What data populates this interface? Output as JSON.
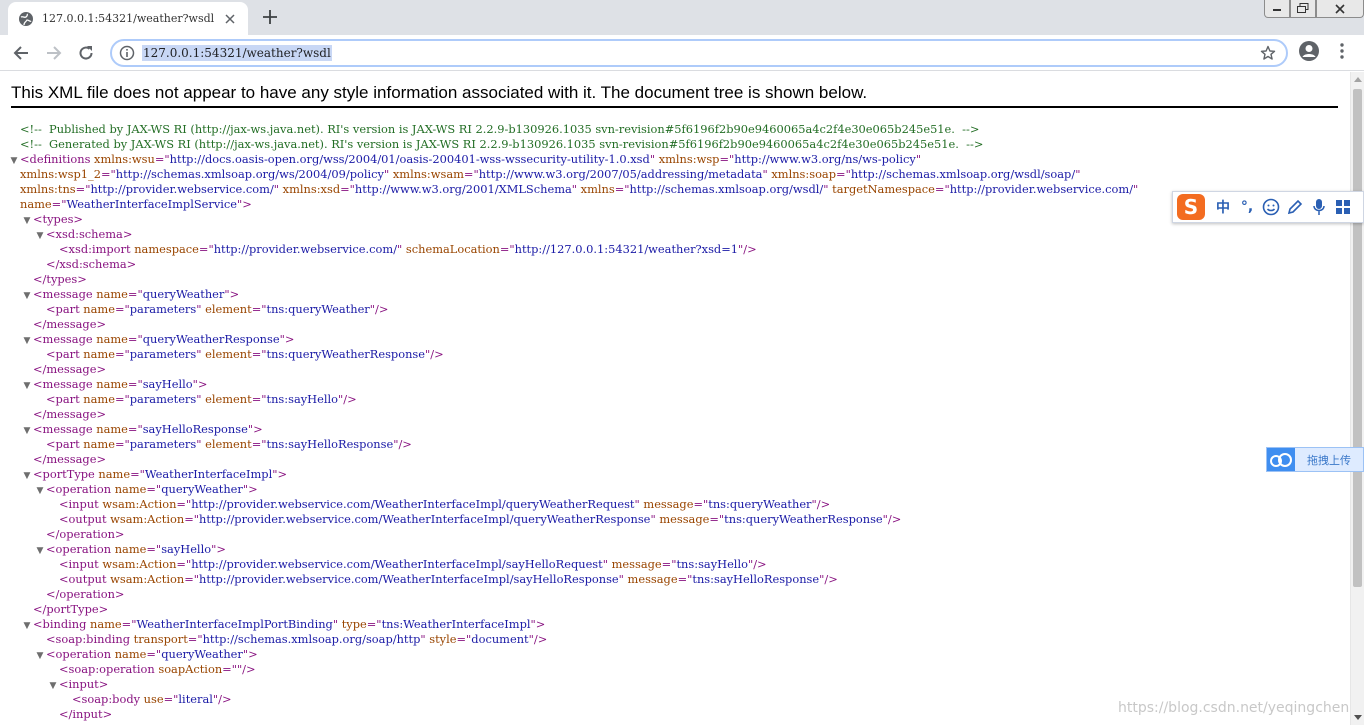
{
  "tab": {
    "title": "127.0.0.1:54321/weather?wsdl",
    "favicon": "globe-icon"
  },
  "address": {
    "url": "127.0.0.1:54321/weather?wsdl"
  },
  "banner": "This XML file does not appear to have any style information associated with it. The document tree is shown below.",
  "ime": {
    "items": [
      "中",
      "°,"
    ]
  },
  "upload": {
    "label": "拖拽上传"
  },
  "watermark": "https://blog.csdn.net/yeqingchen",
  "xml_lines": [
    {
      "tw": "",
      "indent": 0,
      "parts": [
        [
          "c",
          "<!--  Published by JAX-WS RI (http://jax-ws.java.net). RI's version is JAX-WS RI 2.2.9-b130926.1035 svn-revision#5f6196f2b90e9460065a4c2f4e30e065b245e51e.  -->"
        ]
      ]
    },
    {
      "tw": "",
      "indent": 0,
      "parts": [
        [
          "c",
          "<!--  Generated by JAX-WS RI (http://jax-ws.java.net). RI's version is JAX-WS RI 2.2.9-b130926.1035 svn-revision#5f6196f2b90e9460065a4c2f4e30e065b245e51e.  -->"
        ]
      ]
    },
    {
      "tw": "▼",
      "indent": 0,
      "parts": [
        [
          "t",
          "<definitions "
        ],
        [
          "a",
          "xmlns:wsu"
        ],
        [
          "t",
          "=\""
        ],
        [
          "v",
          "http://docs.oasis-open.org/wss/2004/01/oasis-200401-wss-wssecurity-utility-1.0.xsd"
        ],
        [
          "t",
          "\" "
        ],
        [
          "a",
          "xmlns:wsp"
        ],
        [
          "t",
          "=\""
        ],
        [
          "v",
          "http://www.w3.org/ns/ws-policy"
        ],
        [
          "t",
          "\""
        ]
      ]
    },
    {
      "tw": "",
      "indent": 0,
      "parts": [
        [
          "a",
          "xmlns:wsp1_2"
        ],
        [
          "t",
          "=\""
        ],
        [
          "v",
          "http://schemas.xmlsoap.org/ws/2004/09/policy"
        ],
        [
          "t",
          "\" "
        ],
        [
          "a",
          "xmlns:wsam"
        ],
        [
          "t",
          "=\""
        ],
        [
          "v",
          "http://www.w3.org/2007/05/addressing/metadata"
        ],
        [
          "t",
          "\" "
        ],
        [
          "a",
          "xmlns:soap"
        ],
        [
          "t",
          "=\""
        ],
        [
          "v",
          "http://schemas.xmlsoap.org/wsdl/soap/"
        ],
        [
          "t",
          "\""
        ]
      ]
    },
    {
      "tw": "",
      "indent": 0,
      "parts": [
        [
          "a",
          "xmlns:tns"
        ],
        [
          "t",
          "=\""
        ],
        [
          "v",
          "http://provider.webservice.com/"
        ],
        [
          "t",
          "\" "
        ],
        [
          "a",
          "xmlns:xsd"
        ],
        [
          "t",
          "=\""
        ],
        [
          "v",
          "http://www.w3.org/2001/XMLSchema"
        ],
        [
          "t",
          "\" "
        ],
        [
          "a",
          "xmlns"
        ],
        [
          "t",
          "=\""
        ],
        [
          "v",
          "http://schemas.xmlsoap.org/wsdl/"
        ],
        [
          "t",
          "\" "
        ],
        [
          "a",
          "targetNamespace"
        ],
        [
          "t",
          "=\""
        ],
        [
          "v",
          "http://provider.webservice.com/"
        ],
        [
          "t",
          "\""
        ]
      ]
    },
    {
      "tw": "",
      "indent": 0,
      "parts": [
        [
          "a",
          "name"
        ],
        [
          "t",
          "=\""
        ],
        [
          "v",
          "WeatherInterfaceImplService"
        ],
        [
          "t",
          "\">"
        ]
      ]
    },
    {
      "tw": "▼",
      "indent": 1,
      "parts": [
        [
          "t",
          "<types>"
        ]
      ]
    },
    {
      "tw": "▼",
      "indent": 2,
      "parts": [
        [
          "t",
          "<xsd:schema>"
        ]
      ]
    },
    {
      "tw": "",
      "indent": 3,
      "parts": [
        [
          "t",
          "<xsd:import "
        ],
        [
          "a",
          "namespace"
        ],
        [
          "t",
          "=\""
        ],
        [
          "v",
          "http://provider.webservice.com/"
        ],
        [
          "t",
          "\" "
        ],
        [
          "a",
          "schemaLocation"
        ],
        [
          "t",
          "=\""
        ],
        [
          "v",
          "http://127.0.0.1:54321/weather?xsd=1"
        ],
        [
          "t",
          "\"/>"
        ]
      ]
    },
    {
      "tw": "",
      "indent": 2,
      "parts": [
        [
          "t",
          "</xsd:schema>"
        ]
      ]
    },
    {
      "tw": "",
      "indent": 1,
      "parts": [
        [
          "t",
          "</types>"
        ]
      ]
    },
    {
      "tw": "▼",
      "indent": 1,
      "parts": [
        [
          "t",
          "<message "
        ],
        [
          "a",
          "name"
        ],
        [
          "t",
          "=\""
        ],
        [
          "v",
          "queryWeather"
        ],
        [
          "t",
          "\">"
        ]
      ]
    },
    {
      "tw": "",
      "indent": 2,
      "parts": [
        [
          "t",
          "<part "
        ],
        [
          "a",
          "name"
        ],
        [
          "t",
          "=\""
        ],
        [
          "v",
          "parameters"
        ],
        [
          "t",
          "\" "
        ],
        [
          "a",
          "element"
        ],
        [
          "t",
          "=\""
        ],
        [
          "v",
          "tns:queryWeather"
        ],
        [
          "t",
          "\"/>"
        ]
      ]
    },
    {
      "tw": "",
      "indent": 1,
      "parts": [
        [
          "t",
          "</message>"
        ]
      ]
    },
    {
      "tw": "▼",
      "indent": 1,
      "parts": [
        [
          "t",
          "<message "
        ],
        [
          "a",
          "name"
        ],
        [
          "t",
          "=\""
        ],
        [
          "v",
          "queryWeatherResponse"
        ],
        [
          "t",
          "\">"
        ]
      ]
    },
    {
      "tw": "",
      "indent": 2,
      "parts": [
        [
          "t",
          "<part "
        ],
        [
          "a",
          "name"
        ],
        [
          "t",
          "=\""
        ],
        [
          "v",
          "parameters"
        ],
        [
          "t",
          "\" "
        ],
        [
          "a",
          "element"
        ],
        [
          "t",
          "=\""
        ],
        [
          "v",
          "tns:queryWeatherResponse"
        ],
        [
          "t",
          "\"/>"
        ]
      ]
    },
    {
      "tw": "",
      "indent": 1,
      "parts": [
        [
          "t",
          "</message>"
        ]
      ]
    },
    {
      "tw": "▼",
      "indent": 1,
      "parts": [
        [
          "t",
          "<message "
        ],
        [
          "a",
          "name"
        ],
        [
          "t",
          "=\""
        ],
        [
          "v",
          "sayHello"
        ],
        [
          "t",
          "\">"
        ]
      ]
    },
    {
      "tw": "",
      "indent": 2,
      "parts": [
        [
          "t",
          "<part "
        ],
        [
          "a",
          "name"
        ],
        [
          "t",
          "=\""
        ],
        [
          "v",
          "parameters"
        ],
        [
          "t",
          "\" "
        ],
        [
          "a",
          "element"
        ],
        [
          "t",
          "=\""
        ],
        [
          "v",
          "tns:sayHello"
        ],
        [
          "t",
          "\"/>"
        ]
      ]
    },
    {
      "tw": "",
      "indent": 1,
      "parts": [
        [
          "t",
          "</message>"
        ]
      ]
    },
    {
      "tw": "▼",
      "indent": 1,
      "parts": [
        [
          "t",
          "<message "
        ],
        [
          "a",
          "name"
        ],
        [
          "t",
          "=\""
        ],
        [
          "v",
          "sayHelloResponse"
        ],
        [
          "t",
          "\">"
        ]
      ]
    },
    {
      "tw": "",
      "indent": 2,
      "parts": [
        [
          "t",
          "<part "
        ],
        [
          "a",
          "name"
        ],
        [
          "t",
          "=\""
        ],
        [
          "v",
          "parameters"
        ],
        [
          "t",
          "\" "
        ],
        [
          "a",
          "element"
        ],
        [
          "t",
          "=\""
        ],
        [
          "v",
          "tns:sayHelloResponse"
        ],
        [
          "t",
          "\"/>"
        ]
      ]
    },
    {
      "tw": "",
      "indent": 1,
      "parts": [
        [
          "t",
          "</message>"
        ]
      ]
    },
    {
      "tw": "▼",
      "indent": 1,
      "parts": [
        [
          "t",
          "<portType "
        ],
        [
          "a",
          "name"
        ],
        [
          "t",
          "=\""
        ],
        [
          "v",
          "WeatherInterfaceImpl"
        ],
        [
          "t",
          "\">"
        ]
      ]
    },
    {
      "tw": "▼",
      "indent": 2,
      "parts": [
        [
          "t",
          "<operation "
        ],
        [
          "a",
          "name"
        ],
        [
          "t",
          "=\""
        ],
        [
          "v",
          "queryWeather"
        ],
        [
          "t",
          "\">"
        ]
      ]
    },
    {
      "tw": "",
      "indent": 3,
      "parts": [
        [
          "t",
          "<input "
        ],
        [
          "a",
          "wsam:Action"
        ],
        [
          "t",
          "=\""
        ],
        [
          "v",
          "http://provider.webservice.com/WeatherInterfaceImpl/queryWeatherRequest"
        ],
        [
          "t",
          "\" "
        ],
        [
          "a",
          "message"
        ],
        [
          "t",
          "=\""
        ],
        [
          "v",
          "tns:queryWeather"
        ],
        [
          "t",
          "\"/>"
        ]
      ]
    },
    {
      "tw": "",
      "indent": 3,
      "parts": [
        [
          "t",
          "<output "
        ],
        [
          "a",
          "wsam:Action"
        ],
        [
          "t",
          "=\""
        ],
        [
          "v",
          "http://provider.webservice.com/WeatherInterfaceImpl/queryWeatherResponse"
        ],
        [
          "t",
          "\" "
        ],
        [
          "a",
          "message"
        ],
        [
          "t",
          "=\""
        ],
        [
          "v",
          "tns:queryWeatherResponse"
        ],
        [
          "t",
          "\"/>"
        ]
      ]
    },
    {
      "tw": "",
      "indent": 2,
      "parts": [
        [
          "t",
          "</operation>"
        ]
      ]
    },
    {
      "tw": "▼",
      "indent": 2,
      "parts": [
        [
          "t",
          "<operation "
        ],
        [
          "a",
          "name"
        ],
        [
          "t",
          "=\""
        ],
        [
          "v",
          "sayHello"
        ],
        [
          "t",
          "\">"
        ]
      ]
    },
    {
      "tw": "",
      "indent": 3,
      "parts": [
        [
          "t",
          "<input "
        ],
        [
          "a",
          "wsam:Action"
        ],
        [
          "t",
          "=\""
        ],
        [
          "v",
          "http://provider.webservice.com/WeatherInterfaceImpl/sayHelloRequest"
        ],
        [
          "t",
          "\" "
        ],
        [
          "a",
          "message"
        ],
        [
          "t",
          "=\""
        ],
        [
          "v",
          "tns:sayHello"
        ],
        [
          "t",
          "\"/>"
        ]
      ]
    },
    {
      "tw": "",
      "indent": 3,
      "parts": [
        [
          "t",
          "<output "
        ],
        [
          "a",
          "wsam:Action"
        ],
        [
          "t",
          "=\""
        ],
        [
          "v",
          "http://provider.webservice.com/WeatherInterfaceImpl/sayHelloResponse"
        ],
        [
          "t",
          "\" "
        ],
        [
          "a",
          "message"
        ],
        [
          "t",
          "=\""
        ],
        [
          "v",
          "tns:sayHelloResponse"
        ],
        [
          "t",
          "\"/>"
        ]
      ]
    },
    {
      "tw": "",
      "indent": 2,
      "parts": [
        [
          "t",
          "</operation>"
        ]
      ]
    },
    {
      "tw": "",
      "indent": 1,
      "parts": [
        [
          "t",
          "</portType>"
        ]
      ]
    },
    {
      "tw": "▼",
      "indent": 1,
      "parts": [
        [
          "t",
          "<binding "
        ],
        [
          "a",
          "name"
        ],
        [
          "t",
          "=\""
        ],
        [
          "v",
          "WeatherInterfaceImplPortBinding"
        ],
        [
          "t",
          "\" "
        ],
        [
          "a",
          "type"
        ],
        [
          "t",
          "=\""
        ],
        [
          "v",
          "tns:WeatherInterfaceImpl"
        ],
        [
          "t",
          "\">"
        ]
      ]
    },
    {
      "tw": "",
      "indent": 2,
      "parts": [
        [
          "t",
          "<soap:binding "
        ],
        [
          "a",
          "transport"
        ],
        [
          "t",
          "=\""
        ],
        [
          "v",
          "http://schemas.xmlsoap.org/soap/http"
        ],
        [
          "t",
          "\" "
        ],
        [
          "a",
          "style"
        ],
        [
          "t",
          "=\""
        ],
        [
          "v",
          "document"
        ],
        [
          "t",
          "\"/>"
        ]
      ]
    },
    {
      "tw": "▼",
      "indent": 2,
      "parts": [
        [
          "t",
          "<operation "
        ],
        [
          "a",
          "name"
        ],
        [
          "t",
          "=\""
        ],
        [
          "v",
          "queryWeather"
        ],
        [
          "t",
          "\">"
        ]
      ]
    },
    {
      "tw": "",
      "indent": 3,
      "parts": [
        [
          "t",
          "<soap:operation "
        ],
        [
          "a",
          "soapAction"
        ],
        [
          "t",
          "=\"\"/>"
        ]
      ]
    },
    {
      "tw": "▼",
      "indent": 3,
      "parts": [
        [
          "t",
          "<input>"
        ]
      ]
    },
    {
      "tw": "",
      "indent": 4,
      "parts": [
        [
          "t",
          "<soap:body "
        ],
        [
          "a",
          "use"
        ],
        [
          "t",
          "=\""
        ],
        [
          "v",
          "literal"
        ],
        [
          "t",
          "\"/>"
        ]
      ]
    },
    {
      "tw": "",
      "indent": 3,
      "parts": [
        [
          "t",
          "</input>"
        ]
      ]
    }
  ]
}
